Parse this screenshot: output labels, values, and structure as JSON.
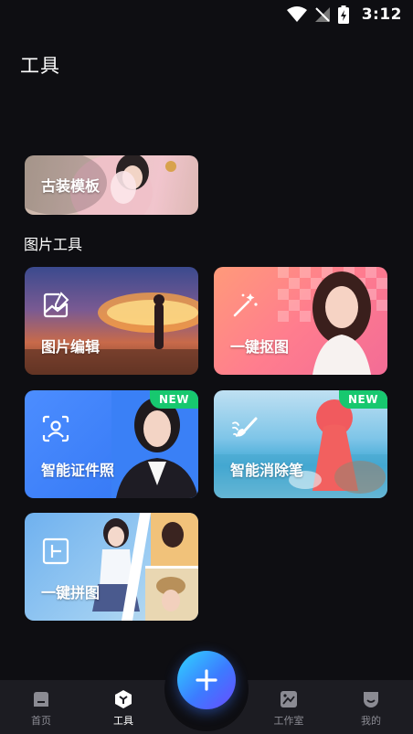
{
  "status": {
    "time": "3:12"
  },
  "header": {
    "title": "工具"
  },
  "partial_card": {
    "label": "古装模板"
  },
  "section": {
    "title": "图片工具"
  },
  "tools": [
    {
      "label": "图片编辑",
      "icon": "image-edit-icon"
    },
    {
      "label": "一键抠图",
      "icon": "magic-wand-icon"
    },
    {
      "label": "智能证件照",
      "icon": "id-photo-icon",
      "badge": "NEW"
    },
    {
      "label": "智能消除笔",
      "icon": "eraser-brush-icon",
      "badge": "NEW"
    },
    {
      "label": "一键拼图",
      "icon": "collage-icon"
    }
  ],
  "nav": {
    "items": [
      {
        "label": "首页",
        "icon": "home-icon"
      },
      {
        "label": "工具",
        "icon": "tools-icon",
        "active": true
      },
      {
        "label": "工作室",
        "icon": "studio-icon"
      },
      {
        "label": "我的",
        "icon": "profile-icon"
      }
    ],
    "fab_icon": "plus-icon"
  },
  "colors": {
    "background": "#0e0e12",
    "navbar": "#1c1c22",
    "badge": "#17c86f",
    "fab_start": "#2fd6ff",
    "fab_end": "#6a4bff"
  }
}
